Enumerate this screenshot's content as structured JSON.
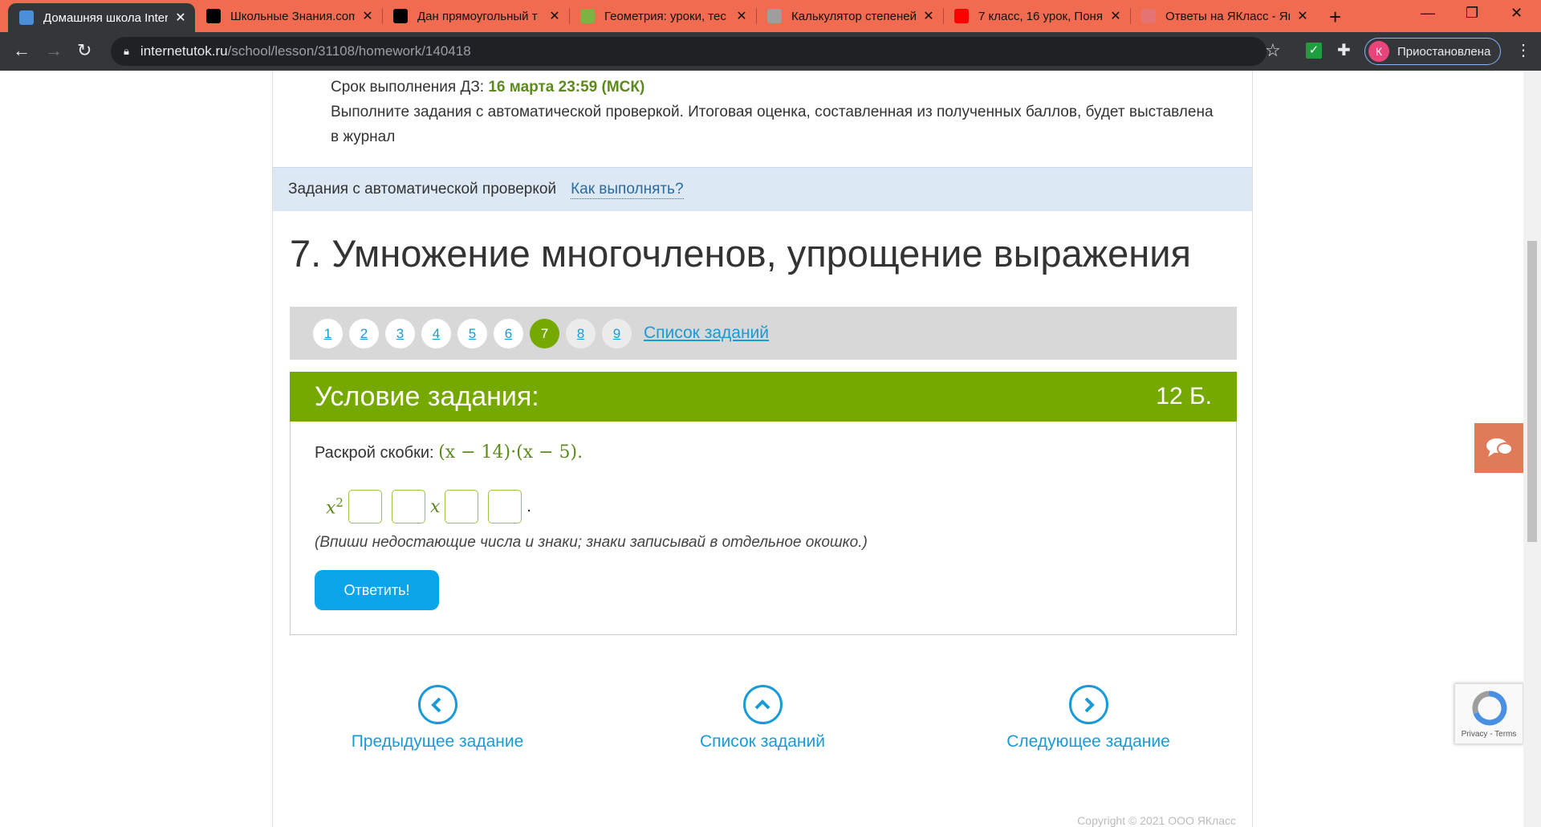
{
  "browser": {
    "tabs": [
      {
        "title": "Домашняя школа InternetUrok",
        "favicon": "play-icon",
        "color": "#4b8fd8",
        "active": true
      },
      {
        "title": "Школьные Знания.com",
        "favicon": "znanija-icon",
        "color": "#000000"
      },
      {
        "title": "Дан прямоугольный т",
        "favicon": "znanija-icon",
        "color": "#000000"
      },
      {
        "title": "Геометрия: уроки, тес",
        "favicon": "book-icon",
        "color": "#7cb342"
      },
      {
        "title": "Калькулятор степеней",
        "favicon": "calculator-icon",
        "color": "#9e9e9e"
      },
      {
        "title": "7 класс, 16 урок, Поня",
        "favicon": "youtube-icon",
        "color": "#ff0000"
      },
      {
        "title": "Ответы на ЯКласс - Як",
        "favicon": "yaklass-icon",
        "color": "#e57373"
      }
    ],
    "url_host": "internetutok.ru",
    "url_path": "/school/lesson/31108/homework/140418",
    "profile_initial": "К",
    "profile_status": "Приостановлена"
  },
  "homework": {
    "deadline_label": "Срок выполнения ДЗ:",
    "deadline_value": "16 марта 23:59 (МСК)",
    "instructions_1": "Выполните задания с автоматической проверкой. Итоговая оценка, составленная из полученных баллов, будет выставлена",
    "instructions_2": "в журнал"
  },
  "band": {
    "label": "Задания с автоматической проверкой",
    "link": "Как выполнять?"
  },
  "title": "7. Умножение многочленов, упрощение выражения",
  "pager": {
    "pages": [
      "1",
      "2",
      "3",
      "4",
      "5",
      "6",
      "7",
      "8",
      "9"
    ],
    "current": "7",
    "list_link": "Список заданий"
  },
  "task": {
    "header": "Условие задания:",
    "points": "12 Б.",
    "prompt": "Раскрой скобки:",
    "expression": "(x − 14)·(x − 5).",
    "answer_prefix": "x",
    "answer_power": "2",
    "answer_var": "x",
    "answer_end": ".",
    "hint": "(Впиши недостающие числа и знаки; знаки записывай в отдельное окошко.)",
    "submit": "Ответить!"
  },
  "nav": {
    "prev": "Предыдущее задание",
    "list": "Список заданий",
    "next": "Следующее задание"
  },
  "footer": {
    "copyright": "Copyright © 2021 ООО ЯКласс"
  },
  "recaptcha": {
    "links": "Privacy - Terms"
  },
  "colors": {
    "accent_green": "#76a900",
    "link_blue": "#1a9ad6",
    "tabbar": "#f06b4f"
  }
}
